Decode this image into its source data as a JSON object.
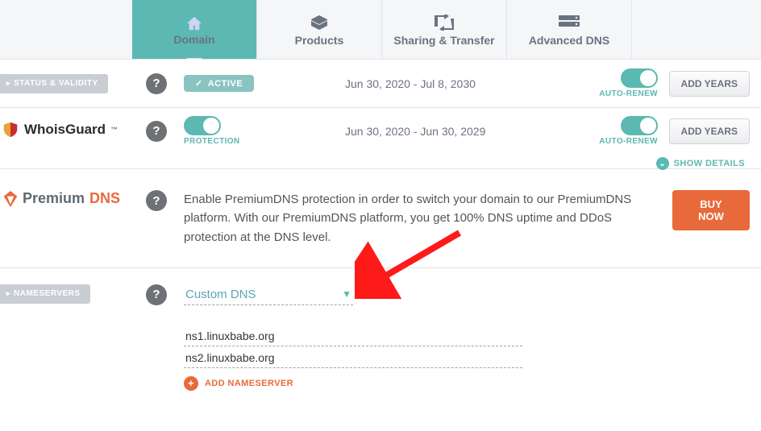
{
  "tabs": {
    "domain": {
      "label": "Domain"
    },
    "products": {
      "label": "Products"
    },
    "sharing": {
      "label": "Sharing & Transfer"
    },
    "dns": {
      "label": "Advanced DNS"
    }
  },
  "status": {
    "section_label": "STATUS & VALIDITY",
    "pill": "ACTIVE",
    "dates": "Jun 30, 2020 - Jul 8, 2030",
    "autorenew_label": "AUTO-RENEW",
    "btn": "ADD YEARS"
  },
  "whoisguard": {
    "brand": "WhoisGuard",
    "tm": "™",
    "protection_label": "PROTECTION",
    "dates": "Jun 30, 2020 - Jun 30, 2029",
    "autorenew_label": "AUTO-RENEW",
    "btn": "ADD YEARS",
    "show_details": "SHOW DETAILS"
  },
  "premiumdns": {
    "brand_p1": "Premium",
    "brand_p2": "DNS",
    "desc": "Enable PremiumDNS protection in order to switch your domain to our PremiumDNS platform. With our PremiumDNS platform, you get 100% DNS uptime and DDoS protection at the DNS level.",
    "btn": "BUY NOW"
  },
  "nameservers": {
    "section_label": "NAMESERVERS",
    "selected": "Custom DNS",
    "records": [
      "ns1.linuxbabe.org",
      "ns2.linuxbabe.org"
    ],
    "add_label": "ADD NAMESERVER"
  }
}
